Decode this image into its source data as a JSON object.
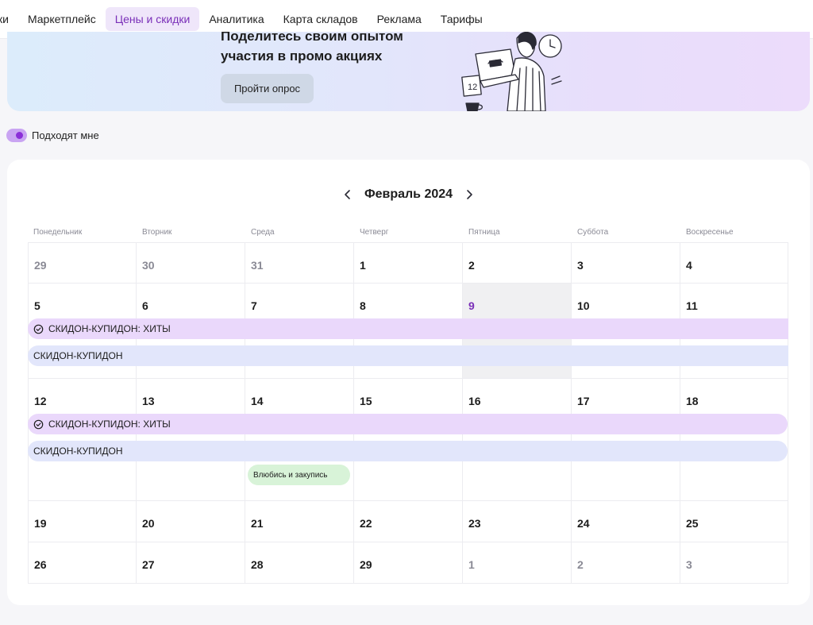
{
  "nav": {
    "items": [
      {
        "label": "ки",
        "active": false
      },
      {
        "label": "Маркетплейс",
        "active": false
      },
      {
        "label": "Цены и скидки",
        "active": true
      },
      {
        "label": "Аналитика",
        "active": false
      },
      {
        "label": "Карта складов",
        "active": false
      },
      {
        "label": "Реклама",
        "active": false
      },
      {
        "label": "Тарифы",
        "active": false
      }
    ]
  },
  "banner": {
    "title_line1": "Поделитесь своим опытом",
    "title_line2": "участия в промо акциях",
    "button_label": "Пройти опрос",
    "illustration_calendar_number": "12"
  },
  "filter": {
    "toggle_label": "Подходят мне",
    "toggle_on": true
  },
  "calendar": {
    "month_label": "Февраль 2024",
    "weekdays": [
      "Понедельник",
      "Вторник",
      "Среда",
      "Четверг",
      "Пятница",
      "Суббота",
      "Воскресенье"
    ],
    "weeks": [
      [
        "29",
        "30",
        "31",
        "1",
        "2",
        "3",
        "4"
      ],
      [
        "5",
        "6",
        "7",
        "8",
        "9",
        "10",
        "11"
      ],
      [
        "12",
        "13",
        "14",
        "15",
        "16",
        "17",
        "18"
      ],
      [
        "19",
        "20",
        "21",
        "22",
        "23",
        "24",
        "25"
      ],
      [
        "26",
        "27",
        "28",
        "29",
        "1",
        "2",
        "3"
      ]
    ],
    "today": "9",
    "promos": {
      "hits": "СКИДОН-КУПИДОН: ХИТЫ",
      "cupid": "СКИДОН-КУПИДОН",
      "love": "Влюбись и закупись"
    }
  },
  "colors": {
    "accent": "#7a2fb8",
    "promo_purple": "#ead8fb",
    "promo_blue": "#e2e6fb",
    "promo_green": "#d8f3d8"
  }
}
